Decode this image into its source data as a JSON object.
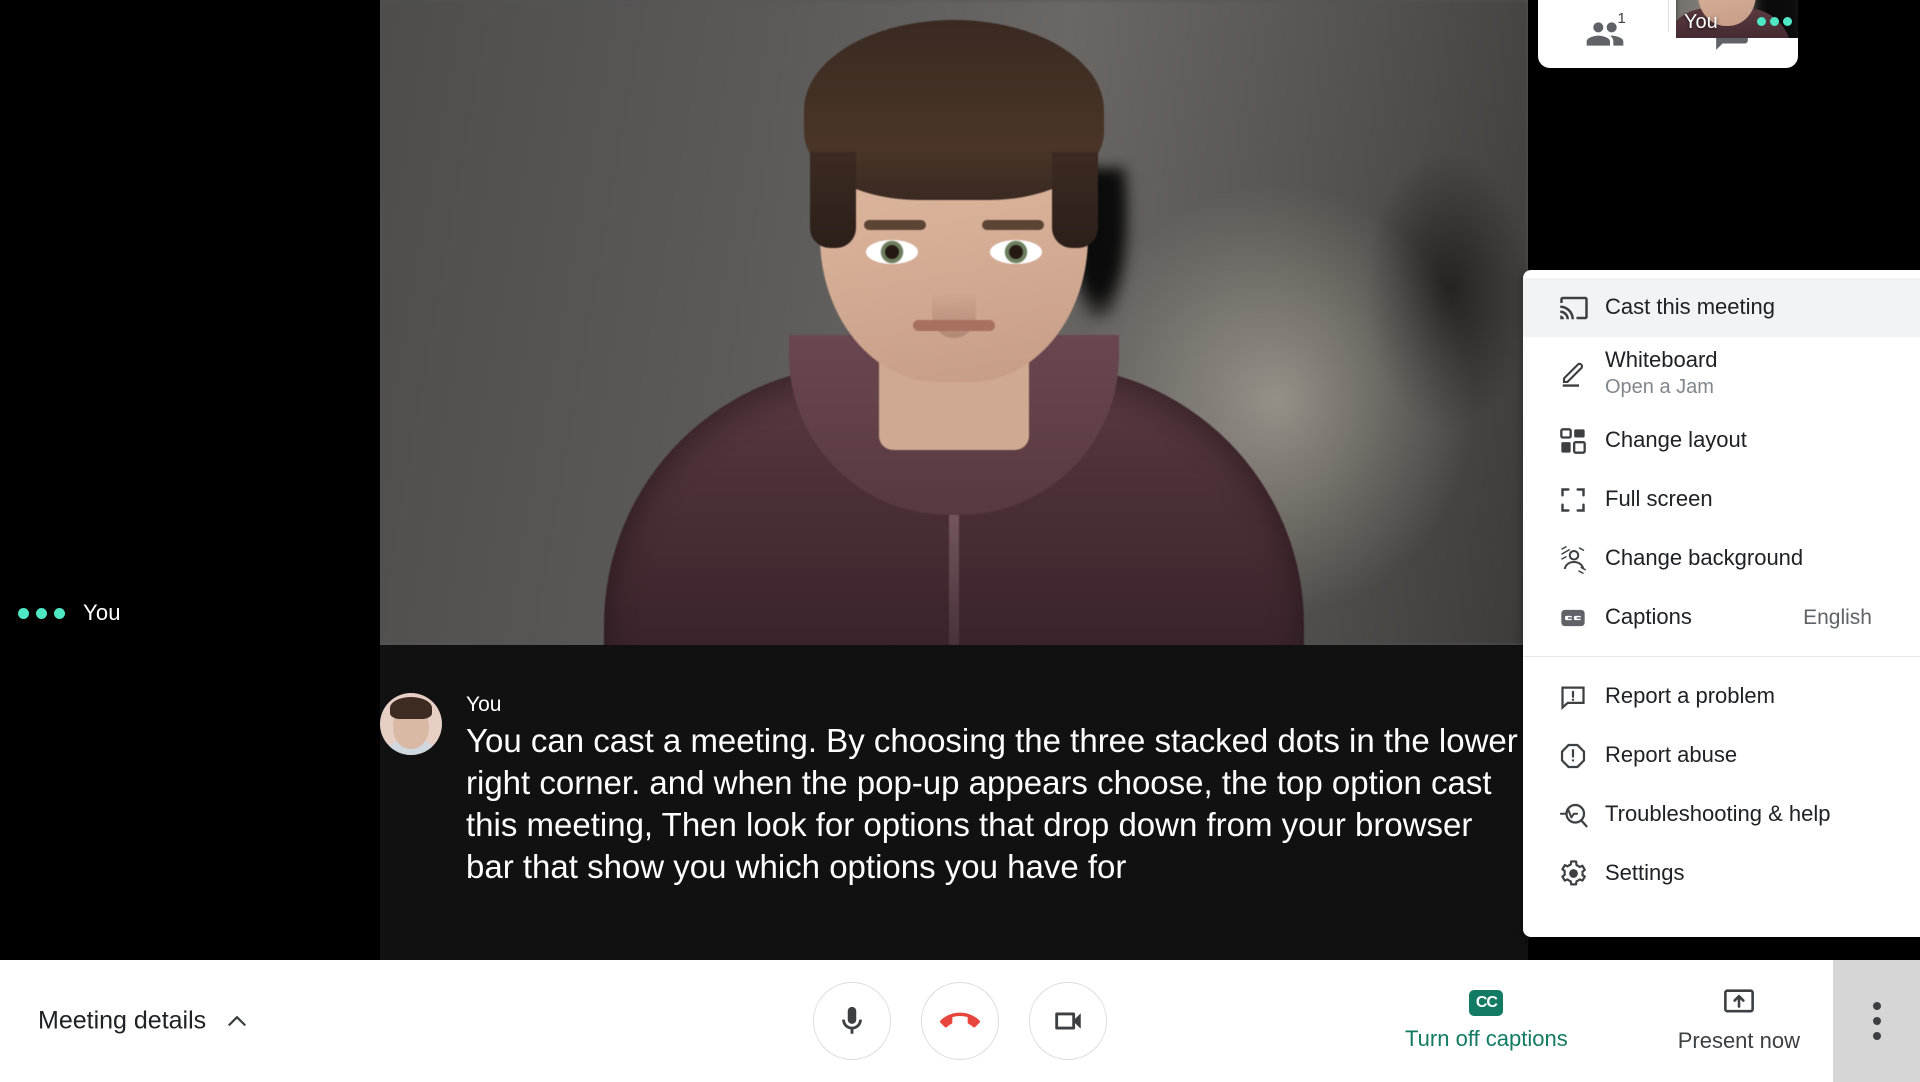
{
  "app": {
    "title": "Google Meet"
  },
  "stage": {
    "self_tile": {
      "name": "You",
      "speaking_indicator": "speaking-dots"
    },
    "header": {
      "people_icon": "people-icon",
      "people_count": "1",
      "chat_icon": "chat-icon",
      "selfview_label": "You"
    }
  },
  "captions": {
    "speaker": "You",
    "text": "You can cast a meeting. By choosing the three stacked dots in the lower right corner. and when the pop-up appears choose, the top option cast this meeting, Then look for options that drop down from your browser bar that show you which options you have for"
  },
  "bottombar": {
    "meeting_details": "Meeting details",
    "chevron_icon": "chevron-up-icon",
    "mic_icon": "microphone-icon",
    "hangup_icon": "end-call-icon",
    "camera_icon": "camera-icon",
    "captions_button": {
      "label": "Turn off captions",
      "icon": "cc-icon",
      "badge": "CC"
    },
    "present_button": {
      "label": "Present now",
      "icon": "present-screen-icon"
    },
    "more_button": {
      "icon": "more-vertical-icon"
    }
  },
  "menu": {
    "items": [
      {
        "id": "cast",
        "icon": "cast-icon",
        "label": "Cast this meeting",
        "sub": "",
        "value": "",
        "active": true
      },
      {
        "id": "whiteboard",
        "icon": "pencil-icon",
        "label": "Whiteboard",
        "sub": "Open a Jam",
        "value": "",
        "active": false
      },
      {
        "id": "layout",
        "icon": "layout-icon",
        "label": "Change layout",
        "sub": "",
        "value": "",
        "active": false
      },
      {
        "id": "fullscreen",
        "icon": "fullscreen-icon",
        "label": "Full screen",
        "sub": "",
        "value": "",
        "active": false
      },
      {
        "id": "background",
        "icon": "background-icon",
        "label": "Change background",
        "sub": "",
        "value": "",
        "active": false
      },
      {
        "id": "captions",
        "icon": "cc-icon",
        "label": "Captions",
        "sub": "",
        "value": "English",
        "active": false
      },
      {
        "id": "problem",
        "icon": "report-problem-icon",
        "label": "Report a problem",
        "sub": "",
        "value": "",
        "active": false
      },
      {
        "id": "abuse",
        "icon": "report-abuse-icon",
        "label": "Report abuse",
        "sub": "",
        "value": "",
        "active": false
      },
      {
        "id": "help",
        "icon": "troubleshoot-icon",
        "label": "Troubleshooting & help",
        "sub": "",
        "value": "",
        "active": false
      },
      {
        "id": "settings",
        "icon": "gear-icon",
        "label": "Settings",
        "sub": "",
        "value": "",
        "active": false
      }
    ]
  },
  "colors": {
    "accent_teal": "#137a63",
    "speaking_dot": "#4fe8c4",
    "hangup_red": "#e8453c",
    "menu_highlight": "#f1f3f4",
    "more_zone_gray": "#d6d6d6"
  }
}
